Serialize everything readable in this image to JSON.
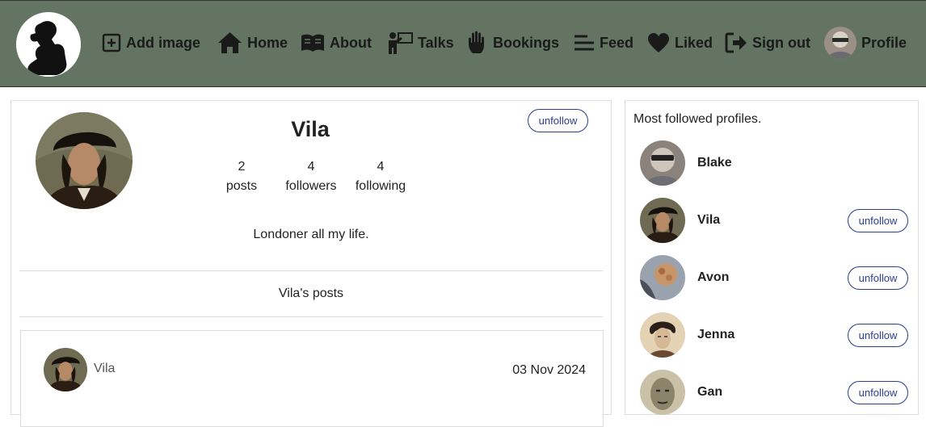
{
  "nav": {
    "items": [
      {
        "label": "Add image",
        "icon": "plus-square-icon"
      },
      {
        "label": "Home",
        "icon": "home-icon"
      },
      {
        "label": "About",
        "icon": "book-icon"
      },
      {
        "label": "Talks",
        "icon": "presentation-icon"
      },
      {
        "label": "Bookings",
        "icon": "hand-icon"
      },
      {
        "label": "Feed",
        "icon": "lines-icon"
      },
      {
        "label": "Liked",
        "icon": "heart-icon"
      },
      {
        "label": "Sign out",
        "icon": "sign-out-icon"
      },
      {
        "label": "Profile",
        "icon": "avatar"
      }
    ],
    "logo": "thinker-logo"
  },
  "profile": {
    "name": "Vila",
    "unfollow_label": "unfollow",
    "posts_count": "2",
    "posts_label": "posts",
    "followers_count": "4",
    "followers_label": "followers",
    "following_count": "4",
    "following_label": "following",
    "bio": "Londoner all my life.",
    "posts_heading": "Vila's posts"
  },
  "post": {
    "author": "Vila",
    "date": "03 Nov 2024"
  },
  "sidebar": {
    "title": "Most followed profiles.",
    "profiles": [
      {
        "name": "Blake",
        "button": ""
      },
      {
        "name": "Vila",
        "button": "unfollow"
      },
      {
        "name": "Avon",
        "button": "unfollow"
      },
      {
        "name": "Jenna",
        "button": "unfollow"
      },
      {
        "name": "Gan",
        "button": "unfollow"
      }
    ]
  },
  "colors": {
    "navbar": "#647462",
    "button_accent": "#2c3e91"
  }
}
